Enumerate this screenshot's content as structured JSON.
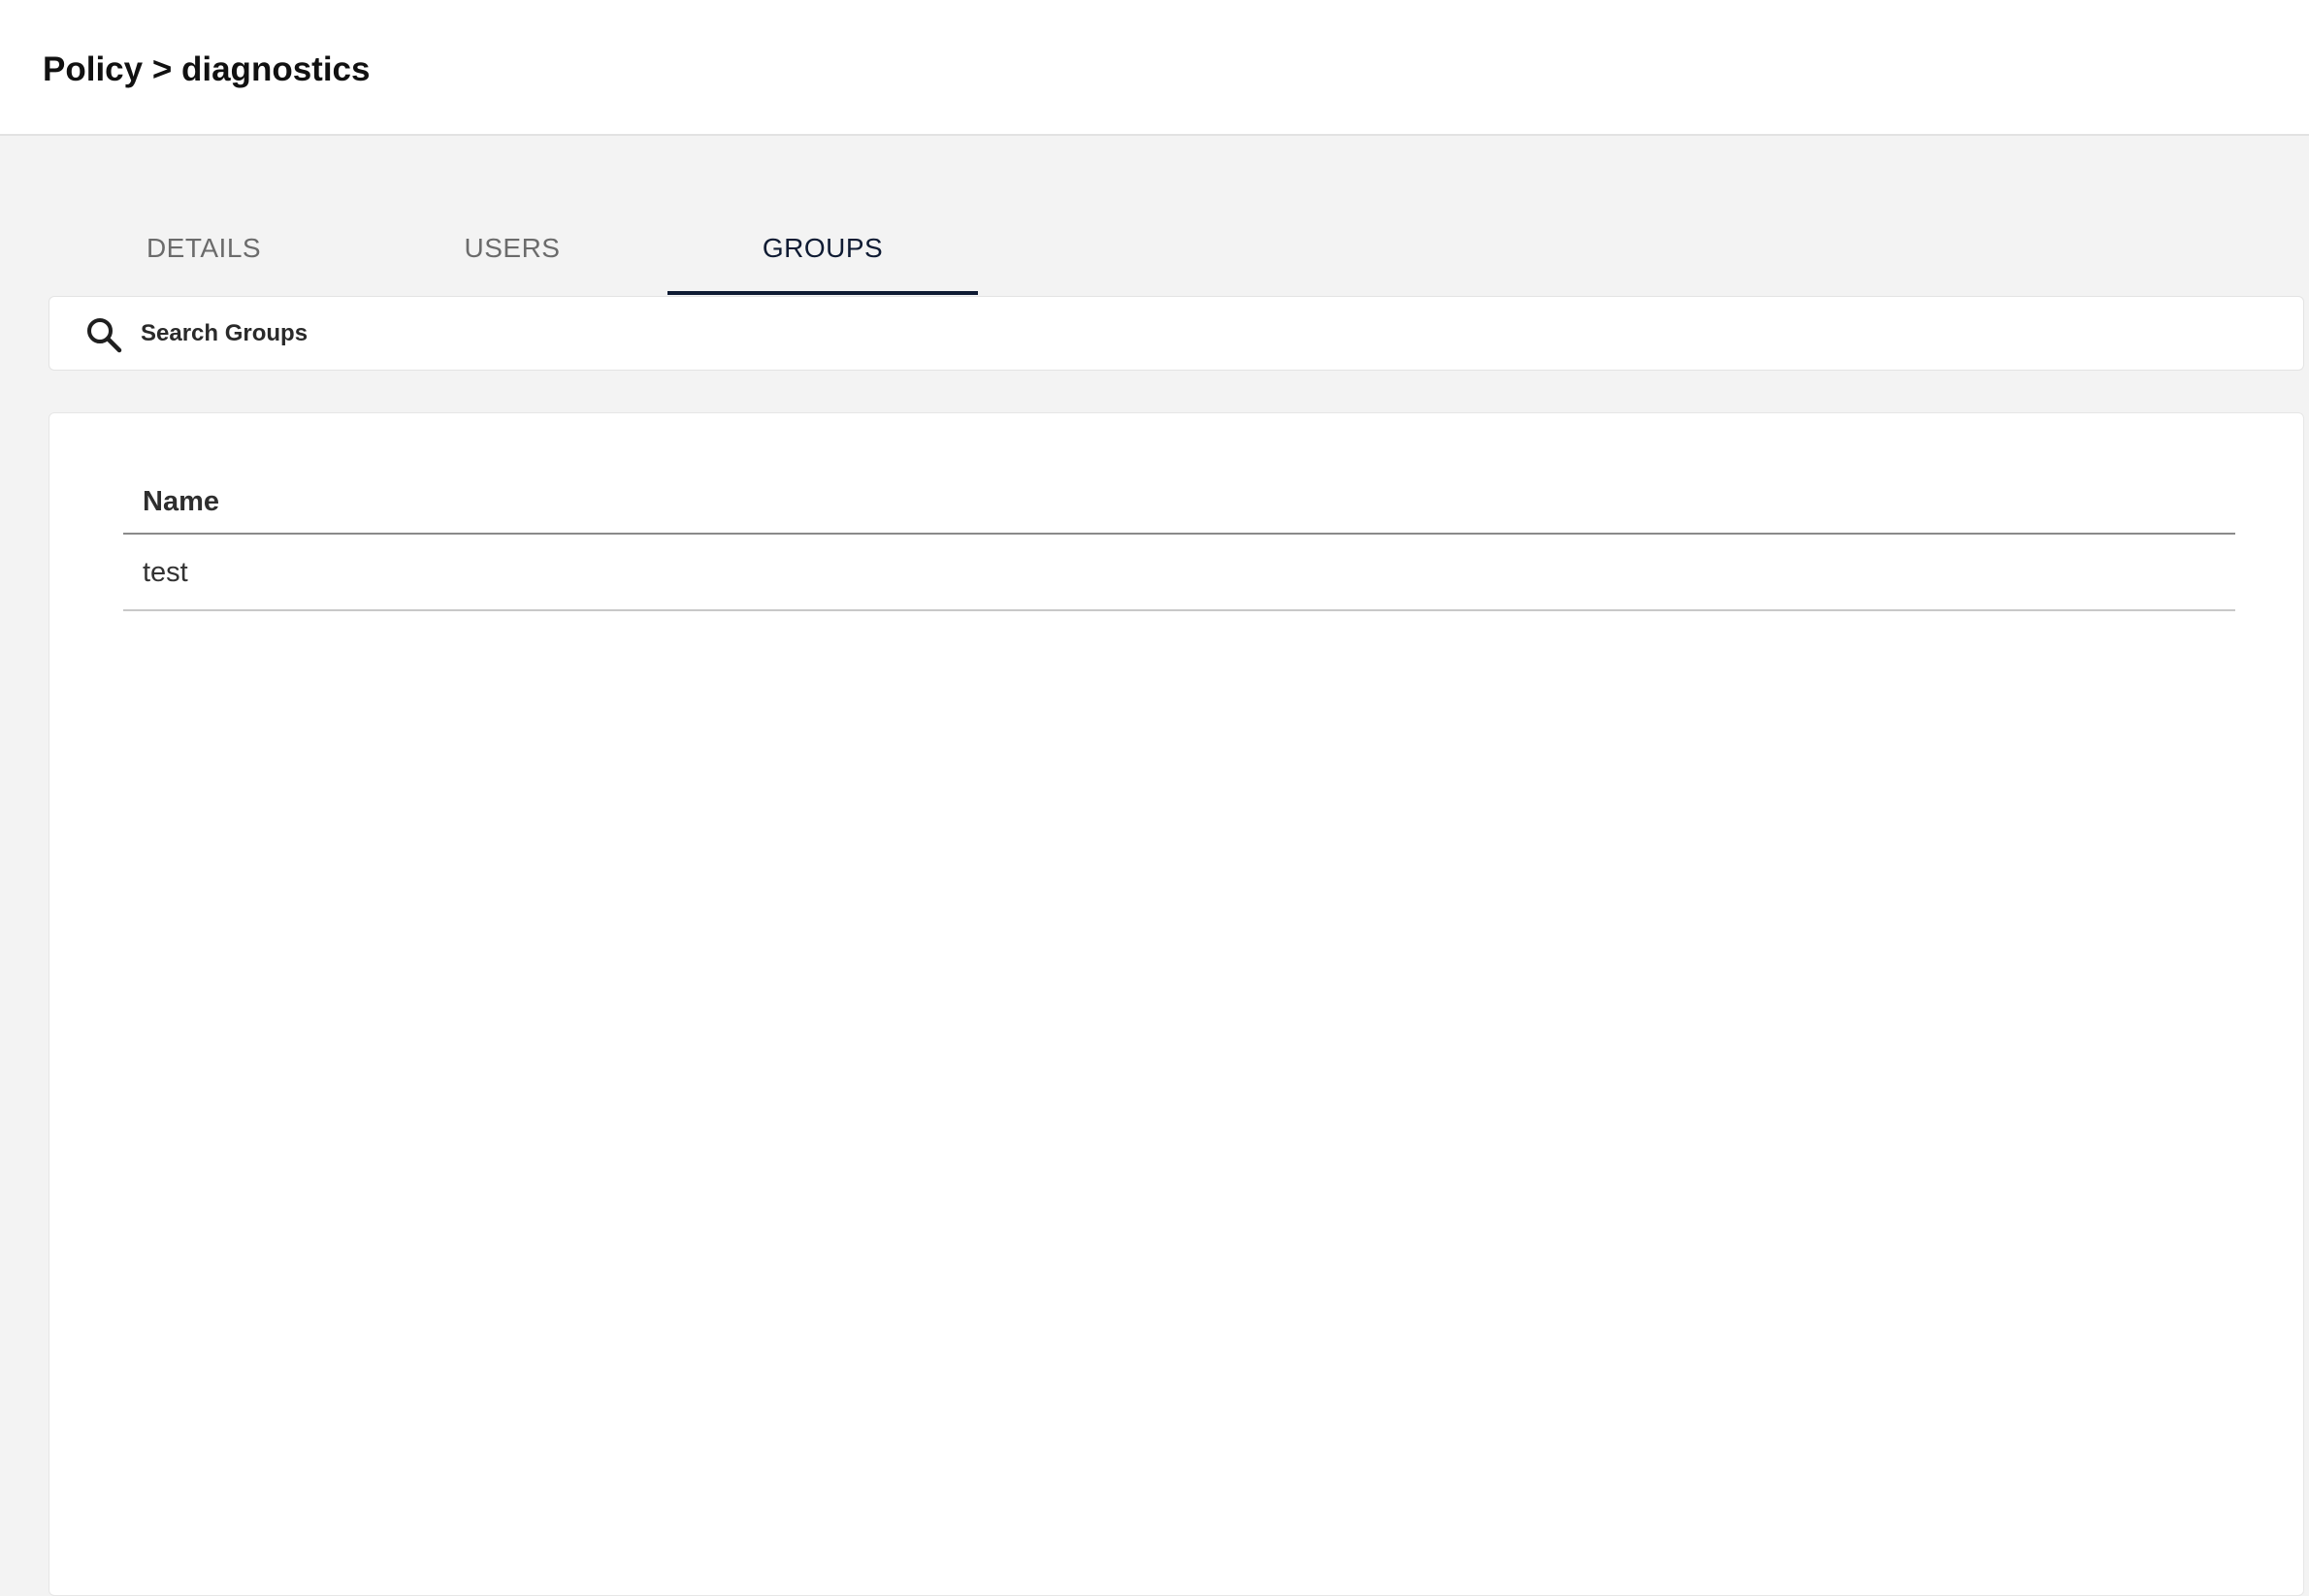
{
  "header": {
    "title": "Policy > diagnostics"
  },
  "tabs": [
    {
      "label": "DETAILS",
      "active": false
    },
    {
      "label": "USERS",
      "active": false
    },
    {
      "label": "GROUPS",
      "active": true
    }
  ],
  "search": {
    "placeholder": "Search Groups",
    "value": "",
    "icon": "search-icon"
  },
  "table": {
    "columns": [
      "Name"
    ],
    "rows": [
      [
        "test"
      ]
    ]
  },
  "colors": {
    "accent": "#0f1b33",
    "background": "#f3f3f3",
    "surface": "#ffffff"
  }
}
